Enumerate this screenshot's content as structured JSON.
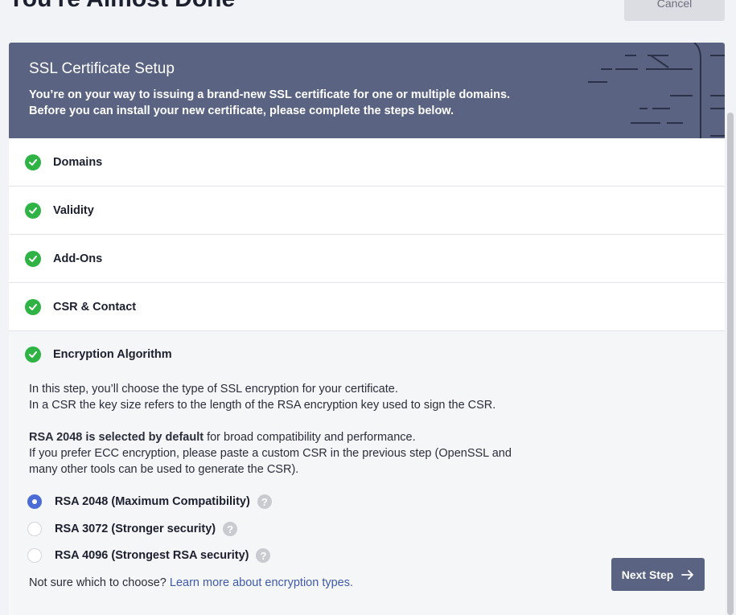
{
  "page": {
    "heading": "You're Almost Done",
    "cancel_label": "Cancel"
  },
  "header": {
    "title": "SSL Certificate Setup",
    "line1": "You’re on your way to issuing a brand-new SSL certificate for one or multiple domains.",
    "line2": "Before you can install your new certificate, please complete the steps below."
  },
  "steps": [
    {
      "label": "Domains",
      "status": "complete"
    },
    {
      "label": "Validity",
      "status": "complete"
    },
    {
      "label": "Add-Ons",
      "status": "complete"
    },
    {
      "label": "CSR & Contact",
      "status": "complete"
    },
    {
      "label": "Encryption Algorithm",
      "status": "active"
    }
  ],
  "encryption": {
    "intro1": "In this step, you’ll choose the type of SSL encryption for your certificate.",
    "intro2": "In a CSR the key size refers to the length of the RSA encryption key used to sign the CSR.",
    "default_bold": "RSA 2048 is selected by default",
    "default_rest": " for broad compatibility and performance.",
    "ecc1": "If you prefer ECC encryption, please paste a custom CSR in the previous step (OpenSSL and",
    "ecc2": "many other tools can be used to generate the CSR).",
    "options": [
      {
        "label": "RSA 2048 (Maximum Compatibility)",
        "selected": true
      },
      {
        "label": "RSA 3072 (Stronger security)",
        "selected": false
      },
      {
        "label": "RSA 4096 (Strongest RSA security)",
        "selected": false
      }
    ],
    "help_glyph": "?",
    "not_sure": "Not sure which to choose? ",
    "learn_more": "Learn more about encryption types.",
    "next_label": "Next Step"
  },
  "colors": {
    "header_bg": "#5a6482",
    "check_green": "#2fb344",
    "radio_selected": "#4a6cd4",
    "link": "#3f5aa8"
  },
  "icons": [
    "check-icon",
    "help-icon",
    "arrow-right-icon",
    "circuit-decoration"
  ]
}
